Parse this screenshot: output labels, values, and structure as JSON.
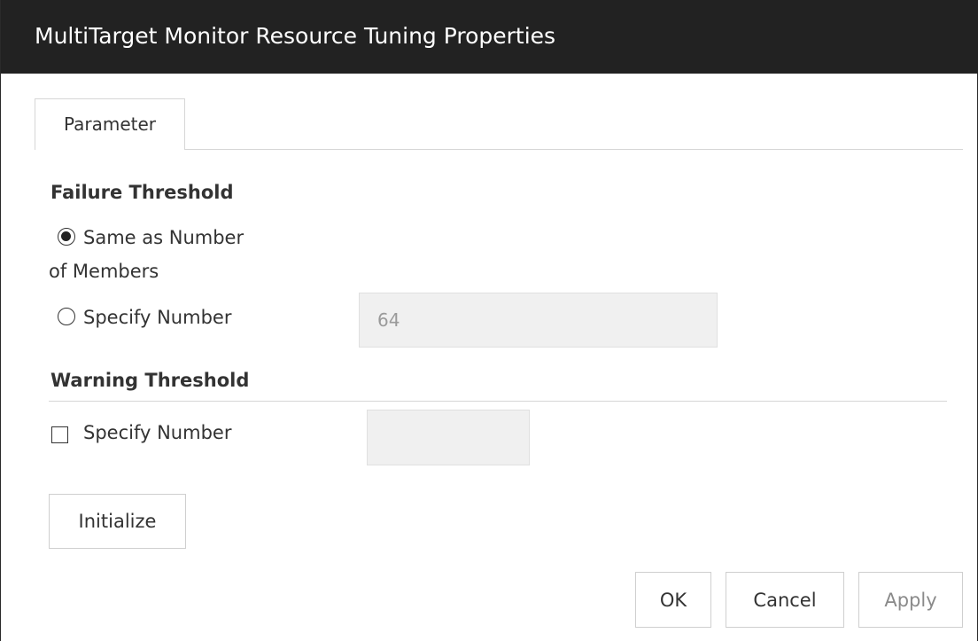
{
  "window": {
    "title": "MultiTarget Monitor Resource Tuning Properties"
  },
  "tabs": [
    {
      "label": "Parameter",
      "active": true
    }
  ],
  "failure_threshold": {
    "heading": "Failure Threshold",
    "option_same_line1": "Same as Number",
    "option_same_line2": "of Members",
    "option_same_selected": true,
    "option_specify": "Specify Number",
    "option_specify_selected": false,
    "number_value": "64"
  },
  "warning_threshold": {
    "heading": "Warning Threshold",
    "checkbox_label": "Specify Number",
    "checked": false,
    "number_value": ""
  },
  "buttons": {
    "initialize": "Initialize",
    "ok": "OK",
    "cancel": "Cancel",
    "apply": "Apply"
  }
}
